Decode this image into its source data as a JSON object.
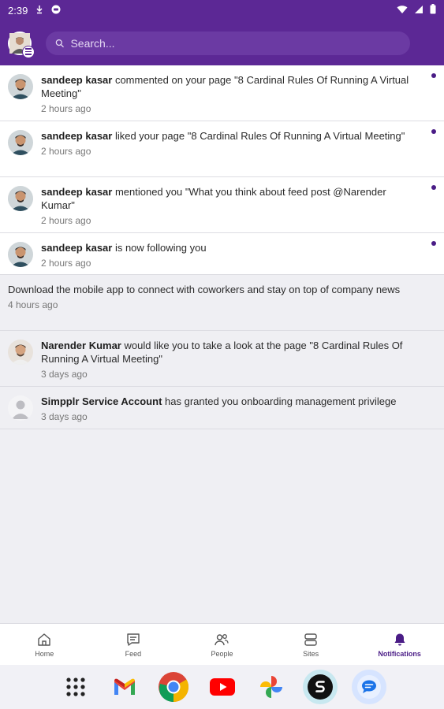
{
  "status_bar": {
    "time": "2:39"
  },
  "search": {
    "placeholder": "Search..."
  },
  "notifications": [
    {
      "actor": "sandeep kasar",
      "text": " commented on your page \"8 Cardinal Rules Of Running A Virtual Meeting\"",
      "time": "2 hours ago",
      "unread": true
    },
    {
      "actor": "sandeep kasar",
      "text": " liked your page \"8 Cardinal Rules Of Running A Virtual Meeting\"",
      "time": "2 hours ago",
      "unread": true
    },
    {
      "actor": "sandeep kasar",
      "text": " mentioned you \"What you think about feed post @Narender Kumar\"",
      "time": "2 hours ago",
      "unread": true
    },
    {
      "actor": "sandeep kasar",
      "text": " is now following you",
      "time": "2 hours ago",
      "unread": true
    }
  ],
  "app_prompt": {
    "text": "Download the mobile app to connect with coworkers and stay on top of company news",
    "time": "4 hours ago"
  },
  "older": [
    {
      "actor": "Narender Kumar",
      "text": " would like you to take a look at the page \"8 Cardinal Rules Of Running A Virtual Meeting\"",
      "time": "3 days ago"
    },
    {
      "actor": "Simpplr Service Account",
      "text": " has granted you onboarding management privilege",
      "time": "3 days ago"
    }
  ],
  "nav": {
    "home": "Home",
    "feed": "Feed",
    "people": "People",
    "sites": "Sites",
    "notifications": "Notifications"
  },
  "colors": {
    "brand": "#5c2895",
    "accent": "#4a1c86"
  },
  "dock_apps": [
    "app-drawer-icon",
    "gmail-icon",
    "chrome-icon",
    "youtube-icon",
    "photos-icon",
    "simpplr-icon",
    "messages-icon"
  ]
}
